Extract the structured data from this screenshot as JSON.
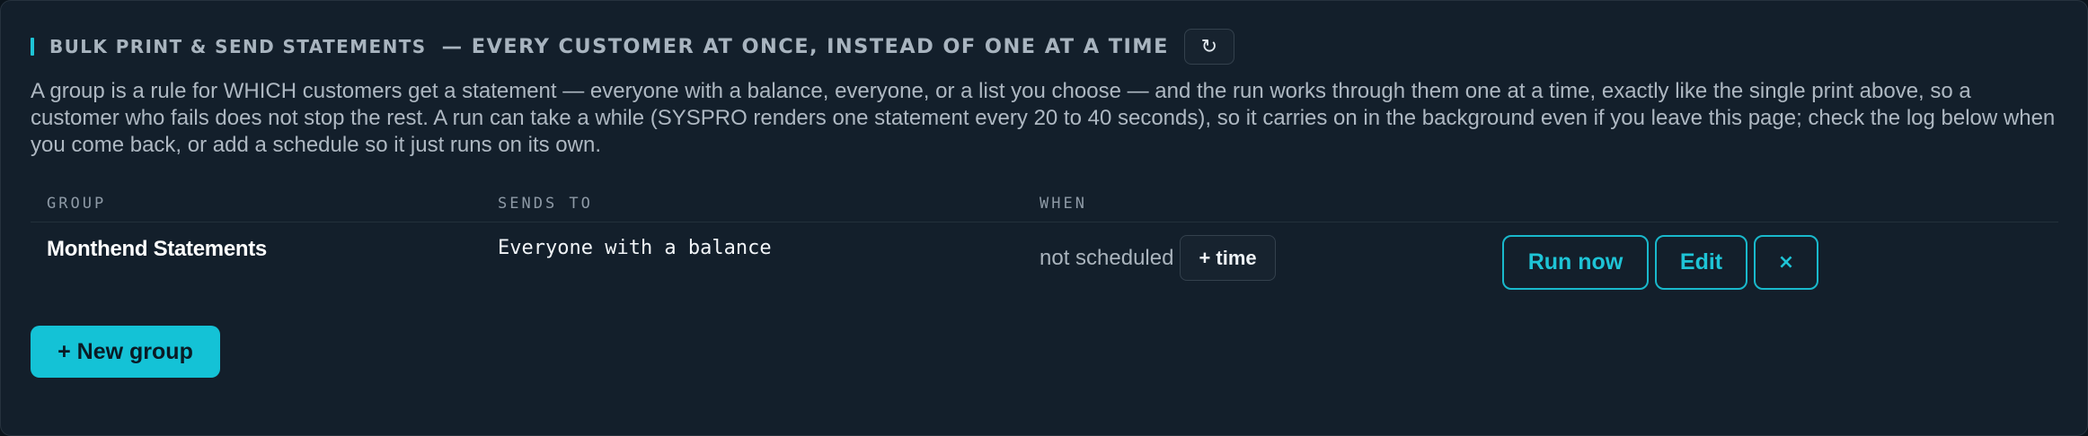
{
  "header": {
    "title": "BULK PRINT & SEND STATEMENTS",
    "subtitle": "— EVERY CUSTOMER AT ONCE, INSTEAD OF ONE AT A TIME",
    "refresh_glyph": "↻"
  },
  "description": "A group is a rule for WHICH customers get a statement — everyone with a balance, everyone, or a list you choose — and the run works through them one at a time, exactly like the single print above, so a customer who fails does not stop the rest. A run can take a while (SYSPRO renders one statement every 20 to 40 seconds), so it carries on in the background even if you leave this page; check the log below when you come back, or add a schedule so it just runs on its own.",
  "table": {
    "columns": [
      "GROUP",
      "SENDS TO",
      "WHEN"
    ],
    "rows": [
      {
        "group": "Monthend Statements",
        "sends_to": "Everyone with a balance",
        "when": "not scheduled",
        "time_button": "+ time",
        "run_now": "Run now",
        "edit": "Edit",
        "delete": "×"
      }
    ]
  },
  "new_group_label": "+ New group",
  "colors": {
    "accent": "#1ec4d6",
    "panel": "#131f2b",
    "background": "#0b141c"
  }
}
